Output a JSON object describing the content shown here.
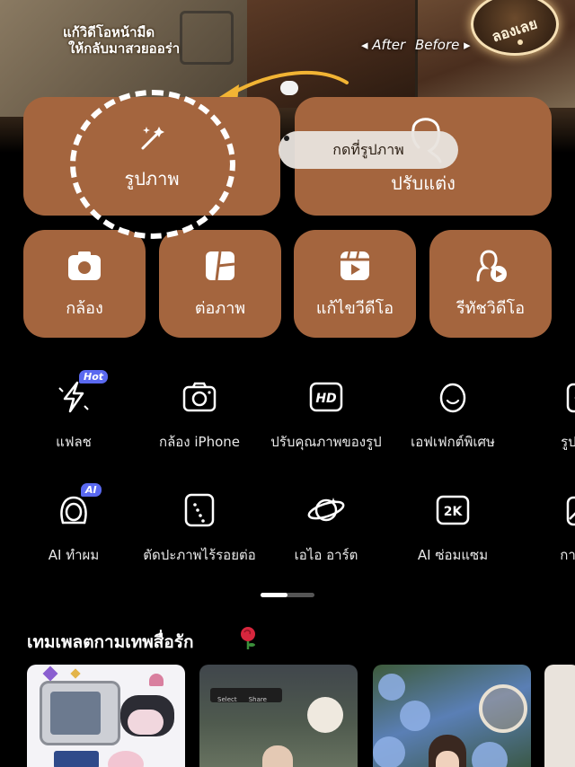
{
  "banner": {
    "subtitle_line1": "แก้วิดีโอหน้ามืด",
    "subtitle_line2": "ให้กลับมาสวยออร่า",
    "after_label": "◂ After",
    "before_label": "Before ▸",
    "try_button": "ลองเลย"
  },
  "main_cards": {
    "photo": "รูปภาพ",
    "retouch": "ปรับแต่ง",
    "camera": "กล้อง",
    "collage": "ต่อภาพ",
    "edit_video": "แก้ไขวีดีโอ",
    "retouch_video": "รีทัชวิดีโอ"
  },
  "tooltip": {
    "text": "กดที่รูปภาพ"
  },
  "tools": [
    {
      "label": "แฟลช",
      "badge": "Hot",
      "icon": "flash-icon"
    },
    {
      "label": "กล้อง iPhone",
      "icon": "camera-icon"
    },
    {
      "label": "ปรับคุณภาพของรูป",
      "icon": "hd-icon"
    },
    {
      "label": "เอฟเฟกต์พิเศษ",
      "icon": "face-icon"
    },
    {
      "label": "รูปถ่าย",
      "icon": "sparkle-photo-icon"
    },
    {
      "label": "AI ทำผม",
      "badge": "AI",
      "icon": "hair-icon"
    },
    {
      "label": "ตัดปะภาพไร้รอยต่อ",
      "icon": "cutout-icon"
    },
    {
      "label": "เอไอ อาร์ต",
      "icon": "planet-icon"
    },
    {
      "label": "AI ซ่อมแซม",
      "icon": "2k-icon"
    },
    {
      "label": "การแช",
      "icon": "image-icon"
    }
  ],
  "templates": {
    "section_title": "เทมเพลตกามเทพสื่อรัก",
    "select_label": "Select",
    "share_label": "Share"
  },
  "colors": {
    "card": "#a4653e",
    "background": "#000000",
    "badge": "#5a69f0"
  }
}
